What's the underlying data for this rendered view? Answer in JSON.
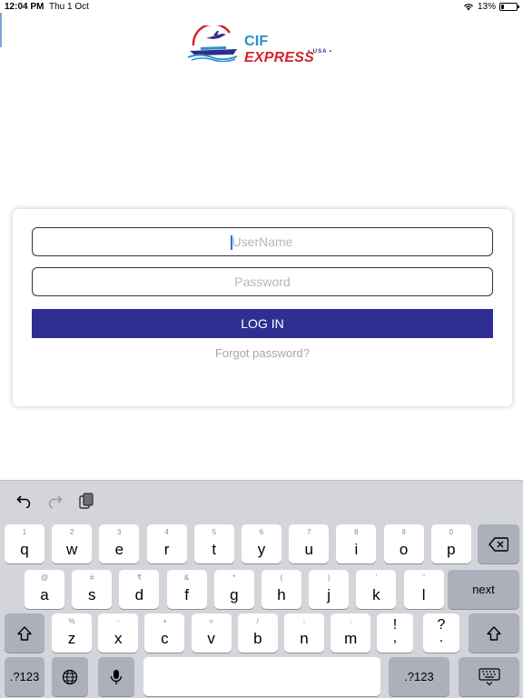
{
  "status": {
    "time": "12:04 PM",
    "date": "Thu 1 Oct",
    "battery": "13%"
  },
  "logo": {
    "brand_main": "CIF",
    "brand_accent": "EXPRESS",
    "brand_sub": "USA"
  },
  "login": {
    "username_placeholder": "UserName",
    "username_value": "",
    "password_placeholder": "Password",
    "password_value": "",
    "login_label": "LOG IN",
    "forgot_label": "Forgot password?"
  },
  "colors": {
    "button": "#2f2f93",
    "brand_blue": "#2b8fcf",
    "brand_red": "#d4242f",
    "keyboard_bg": "#d3d5db"
  },
  "keyboard": {
    "toolbar_icons": [
      "undo-icon",
      "redo-icon",
      "paste-icon"
    ],
    "row1": [
      {
        "hint": "1",
        "key": "q"
      },
      {
        "hint": "2",
        "key": "w"
      },
      {
        "hint": "3",
        "key": "e"
      },
      {
        "hint": "4",
        "key": "r"
      },
      {
        "hint": "5",
        "key": "t"
      },
      {
        "hint": "6",
        "key": "y"
      },
      {
        "hint": "7",
        "key": "u"
      },
      {
        "hint": "8",
        "key": "i"
      },
      {
        "hint": "9",
        "key": "o"
      },
      {
        "hint": "0",
        "key": "p"
      }
    ],
    "row2": [
      {
        "hint": "@",
        "key": "a"
      },
      {
        "hint": "#",
        "key": "s"
      },
      {
        "hint": "₹",
        "key": "d"
      },
      {
        "hint": "&",
        "key": "f"
      },
      {
        "hint": "*",
        "key": "g"
      },
      {
        "hint": "(",
        "key": "h"
      },
      {
        "hint": ")",
        "key": "j"
      },
      {
        "hint": "'",
        "key": "k"
      },
      {
        "hint": "\"",
        "key": "l"
      }
    ],
    "row3": [
      {
        "hint": "%",
        "key": "z"
      },
      {
        "hint": "-",
        "key": "x"
      },
      {
        "hint": "+",
        "key": "c"
      },
      {
        "hint": "=",
        "key": "v"
      },
      {
        "hint": "/",
        "key": "b"
      },
      {
        "hint": ";",
        "key": "n"
      },
      {
        "hint": ":",
        "key": "m"
      }
    ],
    "punct1": {
      "top": "!",
      "bottom": ","
    },
    "punct2": {
      "top": "?",
      "bottom": "."
    },
    "next_label": "next",
    "numbers_label": ".?123",
    "numbers_label_right": ".?123"
  }
}
